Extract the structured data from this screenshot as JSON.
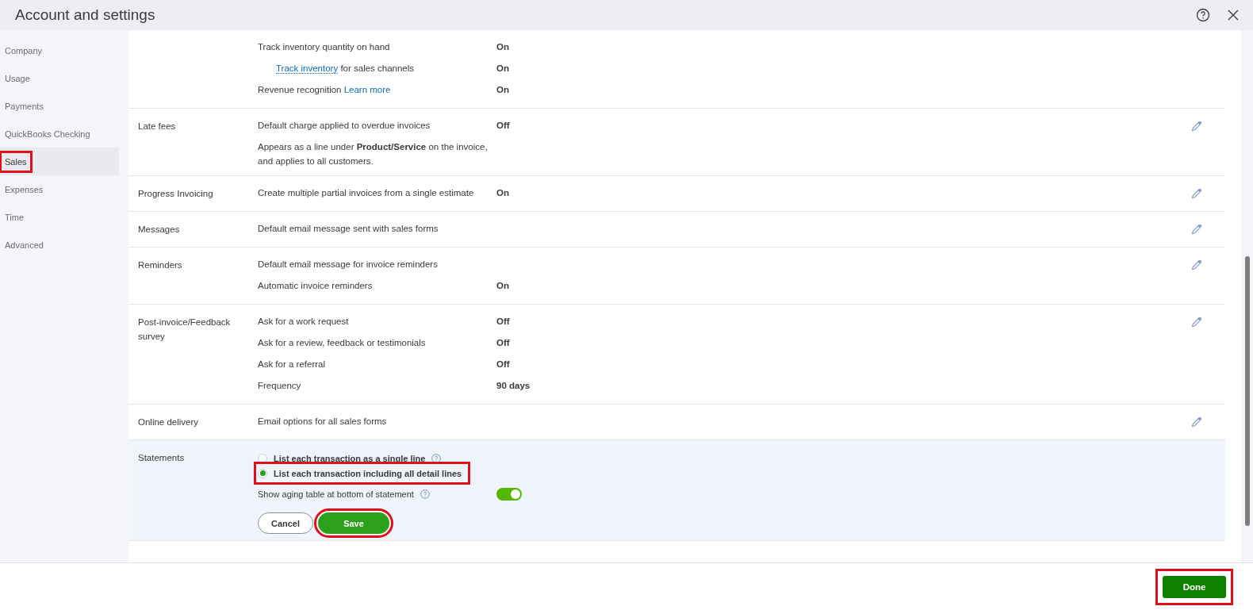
{
  "window": {
    "title": "Account and settings"
  },
  "sidebar": {
    "items": [
      {
        "label": "Company",
        "selected": false,
        "highlighted": false
      },
      {
        "label": "Usage",
        "selected": false,
        "highlighted": false
      },
      {
        "label": "Payments",
        "selected": false,
        "highlighted": false
      },
      {
        "label": "QuickBooks Checking",
        "selected": false,
        "highlighted": false
      },
      {
        "label": "Sales",
        "selected": true,
        "highlighted": true
      },
      {
        "label": "Expenses",
        "selected": false,
        "highlighted": false
      },
      {
        "label": "Time",
        "selected": false,
        "highlighted": false
      },
      {
        "label": "Advanced",
        "selected": false,
        "highlighted": false
      }
    ]
  },
  "sections": [
    {
      "kind": "view",
      "rows": [
        {
          "text": "Track inventory quantity on hand",
          "value": "On",
          "indented": false
        },
        {
          "link": "Track inventory",
          "text": " for sales channels",
          "value": "On",
          "indented": true
        },
        {
          "text": "Revenue recognition ",
          "trailing_link": "Learn more",
          "value": "On",
          "indented": false
        }
      ]
    },
    {
      "kind": "view",
      "label": "Late fees",
      "editable": true,
      "rows": [
        {
          "text": "Default charge applied to overdue invoices",
          "value": "Off",
          "indented": false
        },
        {
          "text": "Appears as a line under **Product/Service** on the invoice, and applies to all customers.",
          "indented": false
        }
      ]
    },
    {
      "kind": "view",
      "label": "Progress Invoicing",
      "editable": true,
      "rows": [
        {
          "text": "Create multiple partial invoices from a single estimate",
          "value": "On",
          "indented": false
        }
      ]
    },
    {
      "kind": "view",
      "label": "Messages",
      "editable": true,
      "rows": [
        {
          "text": "Default email message sent with sales forms",
          "indented": false
        }
      ]
    },
    {
      "kind": "view",
      "label": "Reminders",
      "editable": true,
      "rows": [
        {
          "text": "Default email message for invoice reminders",
          "indented": false
        },
        {
          "text": "Automatic invoice reminders",
          "value": "On",
          "indented": false
        }
      ]
    },
    {
      "kind": "view",
      "label": "Post-invoice/Feedback survey",
      "editable": true,
      "rows": [
        {
          "text": "Ask for a work request",
          "value": "Off",
          "indented": false
        },
        {
          "text": "Ask for a review, feedback or testimonials",
          "value": "Off",
          "indented": false
        },
        {
          "text": "Ask for a referral",
          "value": "Off",
          "indented": false
        },
        {
          "text": "Frequency",
          "value": "90 days",
          "indented": false
        }
      ]
    },
    {
      "kind": "view",
      "label": "Online delivery",
      "editable": true,
      "rows": [
        {
          "text": "Email options for all sales forms",
          "indented": false
        }
      ]
    },
    {
      "kind": "edit",
      "label": "Statements",
      "radios": [
        {
          "label": "List each transaction as a single line",
          "selected": false,
          "highlighted": false,
          "help": true
        },
        {
          "label": "List each transaction including all detail lines",
          "selected": true,
          "highlighted": true
        }
      ],
      "toggle": {
        "label": "Show aging table at bottom of statement",
        "on": true
      },
      "buttons": [
        {
          "label": "Cancel",
          "kind": "secondary",
          "highlighted": false
        },
        {
          "label": "Save",
          "kind": "primary",
          "highlighted": true
        }
      ]
    }
  ],
  "footer": {
    "button": {
      "label": "Done",
      "highlighted": true
    }
  }
}
